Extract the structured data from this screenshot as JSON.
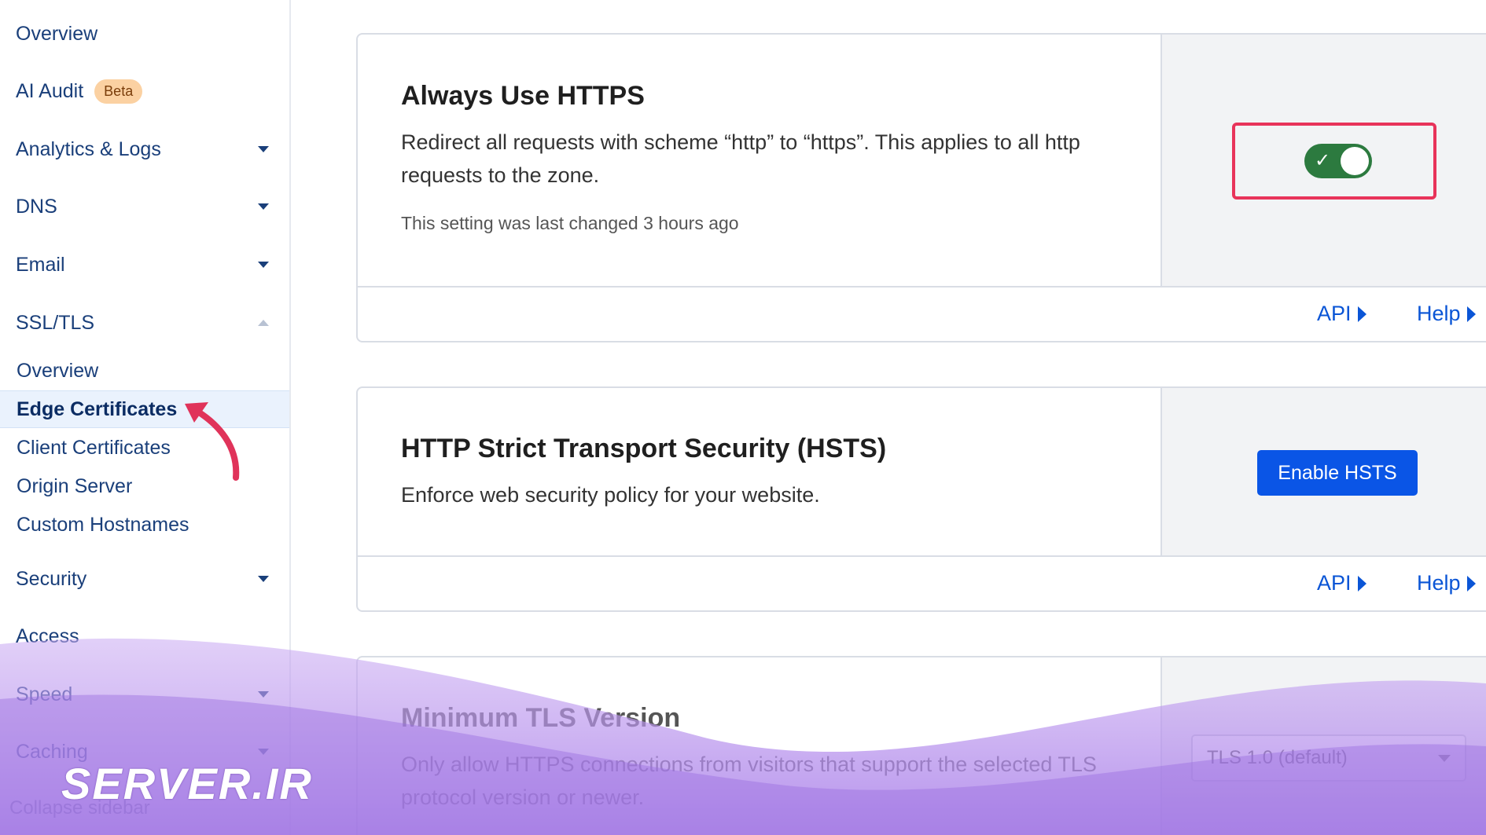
{
  "sidebar": {
    "items": [
      {
        "label": "Overview"
      },
      {
        "label": "AI Audit",
        "badge": "Beta"
      },
      {
        "label": "Analytics & Logs"
      },
      {
        "label": "DNS"
      },
      {
        "label": "Email"
      },
      {
        "label": "SSL/TLS"
      },
      {
        "label": "Security"
      },
      {
        "label": "Access"
      },
      {
        "label": "Speed"
      },
      {
        "label": "Caching"
      }
    ],
    "ssl_sub_items": [
      {
        "label": "Overview"
      },
      {
        "label": "Edge Certificates"
      },
      {
        "label": "Client Certificates"
      },
      {
        "label": "Origin Server"
      },
      {
        "label": "Custom Hostnames"
      }
    ],
    "collapse_label": "Collapse sidebar"
  },
  "cards": {
    "https": {
      "title": "Always Use HTTPS",
      "description": "Redirect all requests with scheme “http” to “https”. This applies to all http requests to the zone.",
      "meta": "This setting was last changed 3 hours ago",
      "toggle_on": true,
      "api_label": "API",
      "help_label": "Help"
    },
    "hsts": {
      "title": "HTTP Strict Transport Security (HSTS)",
      "description": "Enforce web security policy for your website.",
      "button_label": "Enable HSTS",
      "api_label": "API",
      "help_label": "Help"
    },
    "tls": {
      "title": "Minimum TLS Version",
      "description": "Only allow HTTPS connections from visitors that support the selected TLS protocol version or newer.",
      "select_value": "TLS 1.0 (default)"
    }
  },
  "watermark": "SERVER.IR",
  "colors": {
    "link": "#0a55d6",
    "toggle_on": "#2c7a3f",
    "highlight_border": "#e8335a",
    "primary_button": "#0a55e6",
    "badge_bg": "#fbd1a2"
  }
}
